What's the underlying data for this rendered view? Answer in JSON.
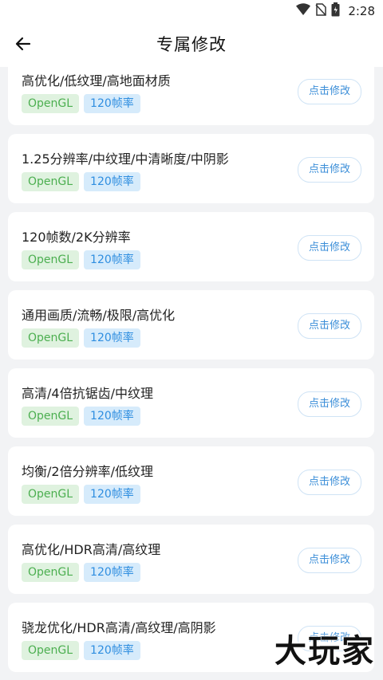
{
  "status": {
    "time": "2:28",
    "icons": [
      "wifi-icon",
      "no-sim-icon",
      "battery-icon"
    ]
  },
  "appbar": {
    "title": "专属修改",
    "back_icon": "arrow-left-icon"
  },
  "cards": [
    {
      "title": "高优化/低纹理/高地面材质",
      "tags": [
        "OpenGL",
        "120帧率"
      ],
      "button": "点击修改"
    },
    {
      "title": "1.25分辨率/中纹理/中清晰度/中阴影",
      "tags": [
        "OpenGL",
        "120帧率"
      ],
      "button": "点击修改"
    },
    {
      "title": "120帧数/2K分辨率",
      "tags": [
        "OpenGL",
        "120帧率"
      ],
      "button": "点击修改"
    },
    {
      "title": "通用画质/流畅/极限/高优化",
      "tags": [
        "OpenGL",
        "120帧率"
      ],
      "button": "点击修改"
    },
    {
      "title": "高清/4倍抗锯齿/中纹理",
      "tags": [
        "OpenGL",
        "120帧率"
      ],
      "button": "点击修改"
    },
    {
      "title": "均衡/2倍分辨率/低纹理",
      "tags": [
        "OpenGL",
        "120帧率"
      ],
      "button": "点击修改"
    },
    {
      "title": "高优化/HDR高清/高纹理",
      "tags": [
        "OpenGL",
        "120帧率"
      ],
      "button": "点击修改"
    },
    {
      "title": "骁龙优化/HDR高清/高纹理/高阴影",
      "tags": [
        "OpenGL",
        "120帧率"
      ],
      "button": "点击修改"
    }
  ],
  "watermark": "大玩家",
  "colors": {
    "tag_green_text": "#4caf50",
    "tag_green_bg": "#dff2df",
    "tag_blue_text": "#2f8ee0",
    "tag_blue_bg": "#d6ebfb",
    "button_text": "#3b8ed8",
    "background": "#f2f3f5"
  }
}
